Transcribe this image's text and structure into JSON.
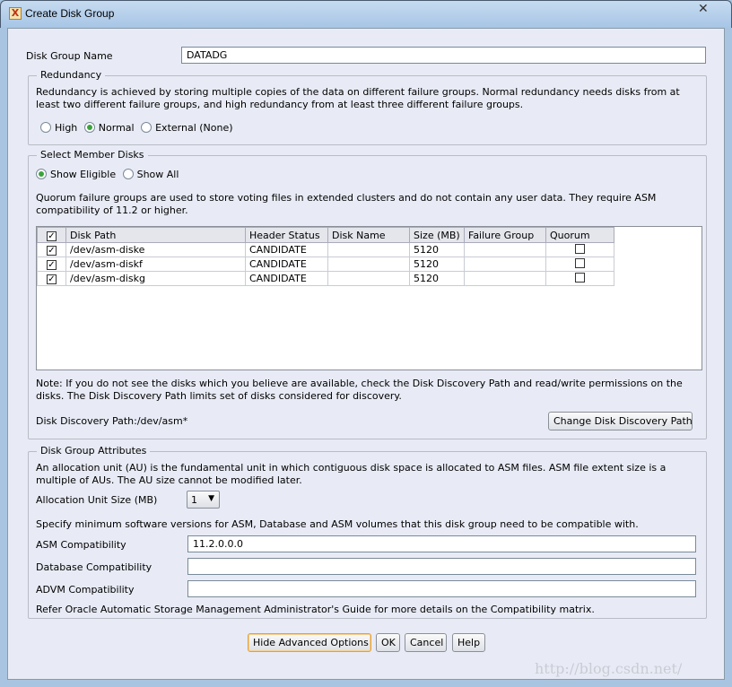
{
  "window": {
    "title": "Create Disk Group",
    "close_icon": "close-icon",
    "app_icon": "oracle-icon"
  },
  "disk_group_name": {
    "label": "Disk Group Name",
    "value": "DATADG"
  },
  "redundancy": {
    "title": "Redundancy",
    "description": "Redundancy is achieved by storing multiple copies of the data on different failure groups. Normal redundancy needs disks from at least two different failure groups, and high redundancy from at least three different failure groups.",
    "options": [
      {
        "label": "High",
        "selected": false
      },
      {
        "label": "Normal",
        "selected": true
      },
      {
        "label": "External (None)",
        "selected": false
      }
    ]
  },
  "member_disks": {
    "title": "Select Member Disks",
    "filters": [
      {
        "label": "Show Eligible",
        "selected": true
      },
      {
        "label": "Show All",
        "selected": false
      }
    ],
    "quorum_note": "Quorum failure groups are used to store voting files in extended clusters and do not contain any user data. They require ASM compatibility of 11.2 or higher.",
    "columns": [
      "Disk Path",
      "Header Status",
      "Disk Name",
      "Size (MB)",
      "Failure Group",
      "Quorum"
    ],
    "header_checked": true,
    "rows": [
      {
        "checked": true,
        "path": "/dev/asm-diske",
        "status": "CANDIDATE",
        "name": "",
        "size": "5120",
        "failure_group": "",
        "quorum": false
      },
      {
        "checked": true,
        "path": "/dev/asm-diskf",
        "status": "CANDIDATE",
        "name": "",
        "size": "5120",
        "failure_group": "",
        "quorum": false
      },
      {
        "checked": true,
        "path": "/dev/asm-diskg",
        "status": "CANDIDATE",
        "name": "",
        "size": "5120",
        "failure_group": "",
        "quorum": false
      }
    ],
    "note": "Note: If you do not see the disks which you believe are available, check the Disk Discovery Path and read/write permissions on the disks. The Disk Discovery Path limits set of disks considered for discovery.",
    "discovery_path": "Disk Discovery Path:/dev/asm*",
    "change_path_button": "Change Disk Discovery Path"
  },
  "attributes": {
    "title": "Disk Group Attributes",
    "au_description": "An allocation unit (AU) is the fundamental unit in which contiguous disk space is allocated to ASM files. ASM file extent size is a multiple of AUs. The AU size cannot be modified later.",
    "au_label": "Allocation Unit Size (MB)",
    "au_value": "1",
    "compat_description": "Specify minimum software versions for ASM, Database and ASM volumes that this disk group need to be compatible with.",
    "asm_label": "ASM Compatibility",
    "asm_value": "11.2.0.0.0",
    "db_label": "Database Compatibility",
    "db_value": "",
    "advm_label": "ADVM Compatibility",
    "advm_value": "",
    "refer": "Refer Oracle Automatic Storage Management Administrator's Guide for more details on the Compatibility matrix."
  },
  "buttons": {
    "hide_advanced": "Hide Advanced Options",
    "ok": "OK",
    "cancel": "Cancel",
    "help": "Help"
  },
  "watermark": "http://blog.csdn.net/"
}
